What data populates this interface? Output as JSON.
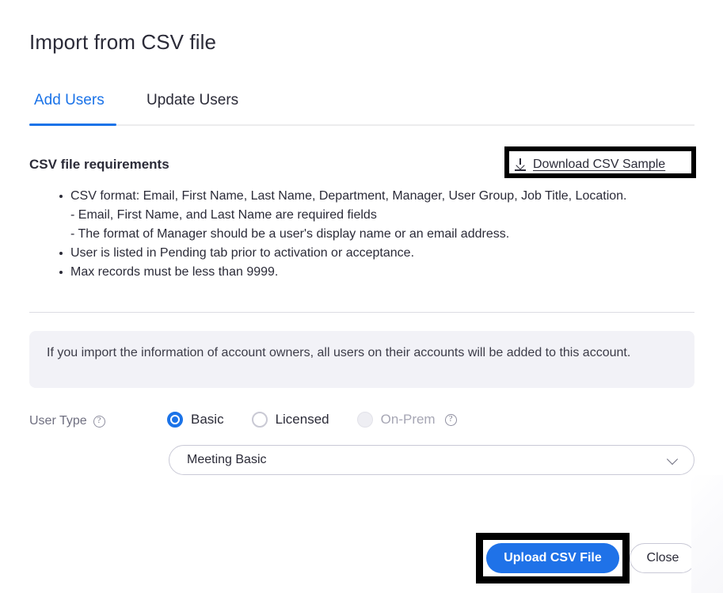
{
  "dialog": {
    "title": "Import from CSV file"
  },
  "tabs": [
    {
      "label": "Add Users",
      "active": true
    },
    {
      "label": "Update Users",
      "active": false
    }
  ],
  "requirements": {
    "heading": "CSV file requirements",
    "download_link": {
      "label": "Download CSV Sample",
      "icon": "download-icon"
    },
    "items": [
      "CSV format: Email, First Name, Last Name, Department, Manager, User Group, Job Title, Location.",
      "- Email, First Name, and Last Name are required fields",
      "- The format of Manager should be a user's display name or an email address.",
      "User is listed in Pending tab prior to activation or acceptance.",
      "Max records must be less than 9999."
    ]
  },
  "info_banner": {
    "text": "If you import the information of account owners, all users on their accounts will be added to this account."
  },
  "user_type": {
    "label": "User Type",
    "help_icon": "question-mark-circle-icon",
    "options": [
      {
        "label": "Basic",
        "selected": true,
        "disabled": false,
        "help_icon": null
      },
      {
        "label": "Licensed",
        "selected": false,
        "disabled": false,
        "help_icon": null
      },
      {
        "label": "On-Prem",
        "selected": false,
        "disabled": true,
        "help_icon": "question-mark-circle-icon"
      }
    ],
    "plan_select": {
      "value": "Meeting Basic",
      "chevron_icon": "chevron-down-icon"
    }
  },
  "footer": {
    "upload_label": "Upload CSV File",
    "close_label": "Close"
  },
  "colors": {
    "accent_blue": "#1b73e8",
    "button_blue": "#1f72e8",
    "annotation_black": "#000000",
    "banner_bg": "#f2f2f7",
    "text_primary": "#2b2b38",
    "text_muted": "#6f6f80",
    "text_disabled": "#a6a6b4",
    "border_gray": "#c9c9d6"
  }
}
